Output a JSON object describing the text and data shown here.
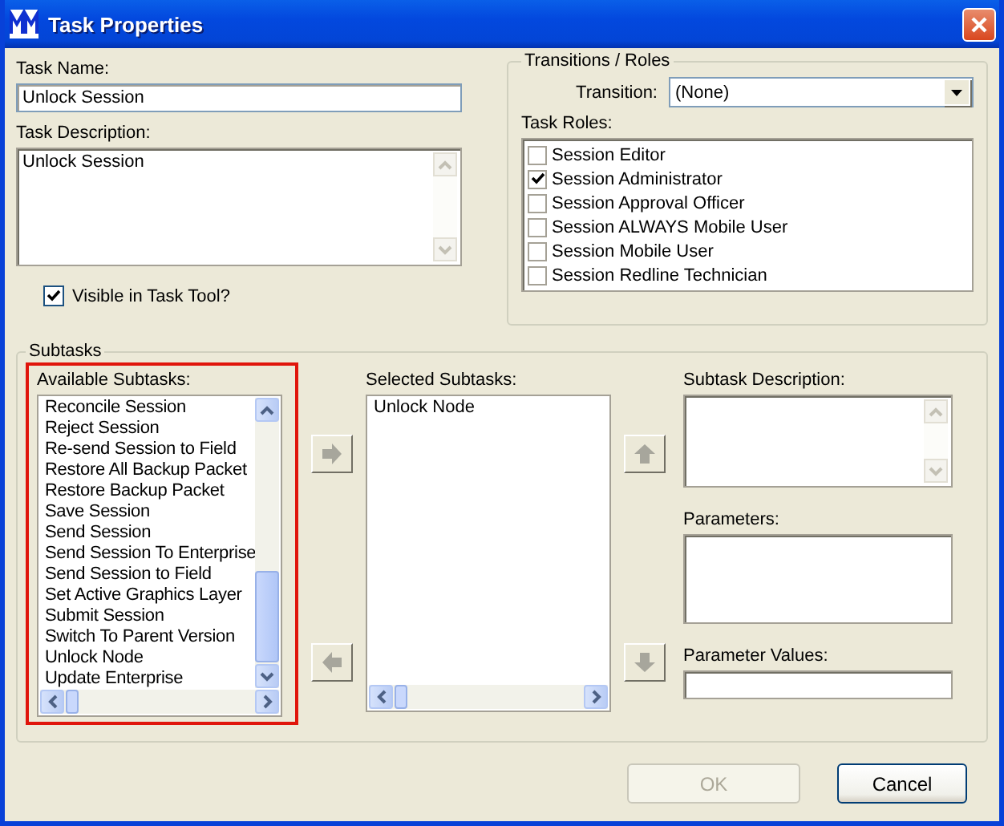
{
  "window": {
    "title": "Task Properties"
  },
  "task_name": {
    "label": "Task Name:",
    "value": "Unlock Session"
  },
  "task_description": {
    "label": "Task Description:",
    "value": "Unlock Session"
  },
  "visible_in_task_tool": {
    "label": "Visible in Task Tool?",
    "checked": true
  },
  "transitions_roles": {
    "title": "Transitions / Roles",
    "transition_label": "Transition:",
    "transition_value": "(None)",
    "roles_label": "Task Roles:",
    "roles": [
      {
        "label": "Session Editor",
        "checked": false
      },
      {
        "label": "Session Administrator",
        "checked": true
      },
      {
        "label": "Session Approval Officer",
        "checked": false
      },
      {
        "label": "Session ALWAYS Mobile User",
        "checked": false
      },
      {
        "label": "Session Mobile User",
        "checked": false
      },
      {
        "label": "Session Redline Technician",
        "checked": false
      }
    ]
  },
  "subtasks": {
    "title": "Subtasks",
    "available_label": "Available Subtasks:",
    "available": [
      "Reconcile Session",
      "Reject Session",
      "Re-send Session to Field",
      "Restore All Backup Packet",
      "Restore Backup Packet",
      "Save Session",
      "Send Session",
      "Send Session To Enterprise",
      "Send Session to Field",
      "Set Active Graphics Layer",
      "Submit Session",
      "Switch To Parent Version",
      "Unlock Node",
      "Update Enterprise"
    ],
    "selected_label": "Selected Subtasks:",
    "selected": [
      "Unlock Node"
    ],
    "description_label": "Subtask Description:",
    "parameters_label": "Parameters:",
    "parameter_values_label": "Parameter Values:"
  },
  "buttons": [
    {
      "label": "OK",
      "disabled": true
    },
    {
      "label": "Cancel",
      "disabled": false
    }
  ]
}
